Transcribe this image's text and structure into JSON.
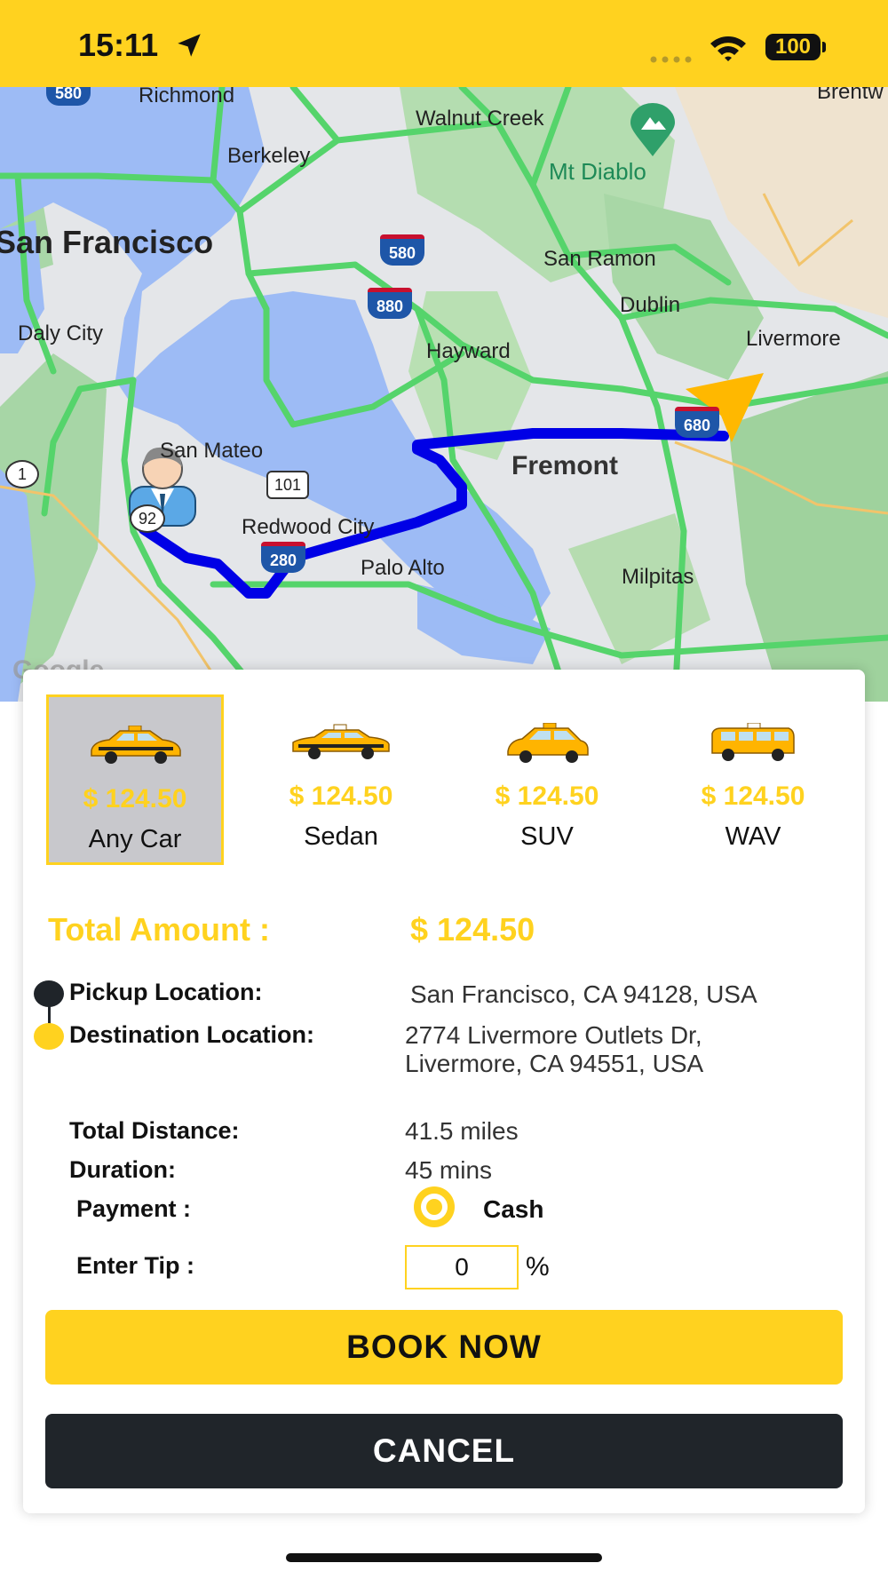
{
  "status_bar": {
    "time": "15:11",
    "battery": "100",
    "icons": [
      "location-arrow-icon",
      "signal-dots-icon",
      "wifi-icon",
      "battery-icon"
    ]
  },
  "map": {
    "labels": {
      "richmond": "Richmond",
      "walnut_creek": "Walnut Creek",
      "brentwood": "Brentw",
      "berkeley": "Berkeley",
      "mt_diablo": "Mt Diablo",
      "san_francisco": "San Francisco",
      "san_ramon": "San Ramon",
      "dublin": "Dublin",
      "livermore": "Livermore",
      "daly_city": "Daly City",
      "hayward": "Hayward",
      "san_mateo": "San Mateo",
      "fremont": "Fremont",
      "redwood_city": "Redwood City",
      "palo_alto": "Palo Alto",
      "milpitas": "Milpitas"
    },
    "shields": {
      "i580_top": "580",
      "i580": "580",
      "i880": "880",
      "i680": "680",
      "i280": "280",
      "us101": "101",
      "r92": "92",
      "r1": "1"
    },
    "logo": "Google",
    "colors": {
      "route": "#0000E6",
      "highway": "#55D46B",
      "water": "#9DBBF5",
      "marker": "#FFB800"
    }
  },
  "vehicles": [
    {
      "price": "$ 124.50",
      "name": "Any Car",
      "selected": true
    },
    {
      "price": "$ 124.50",
      "name": "Sedan",
      "selected": false
    },
    {
      "price": "$ 124.50",
      "name": "SUV",
      "selected": false
    },
    {
      "price": "$ 124.50",
      "name": "WAV",
      "selected": false
    }
  ],
  "summary": {
    "total_label": "Total Amount :",
    "total_value": "$ 124.50",
    "pickup_label": "Pickup Location:",
    "pickup_value": "San Francisco, CA 94128, USA",
    "destination_label": "Destination Location:",
    "destination_line1": "2774 Livermore Outlets Dr,",
    "destination_line2": "Livermore, CA 94551, USA",
    "distance_label": "Total Distance:",
    "distance_value": "41.5 miles",
    "duration_label": "Duration:",
    "duration_value": "45 mins",
    "payment_label": "Payment :",
    "payment_value": "Cash",
    "tip_label": "Enter Tip :",
    "tip_value": "0",
    "tip_unit": "%"
  },
  "buttons": {
    "book": "BOOK NOW",
    "cancel": "CANCEL"
  },
  "colors": {
    "accent": "#FFD21F",
    "dark": "#20252A"
  }
}
